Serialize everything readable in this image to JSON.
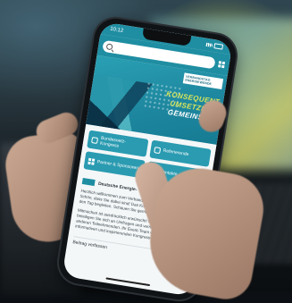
{
  "phone": {
    "time": "10:12",
    "hero": {
      "logo_line1": "VERBANDSTAG",
      "logo_line2": "ENERGIEWENDE",
      "line1": "KONSEQUENT",
      "line2": "UMSETZEN –",
      "line3": "GEMEINSAM."
    },
    "tiles": [
      {
        "label": "Bundesnetz- Kongress"
      },
      {
        "label": "Referierende"
      },
      {
        "label": "Partner & Sponsoren"
      },
      {
        "label": "Kontakte"
      }
    ],
    "org_name": "Deutsche Energie-",
    "paragraph1": "Herzlich willkommen zum Verbandstag Energiewende-Kongress. Schön, dass Sie dabei sind! Das Kongressteam wird Sie durch den Tag begleiten. Schauen Sie gerne wieder rein!",
    "paragraph2": "Mitmachen ist ausdrücklich erwünscht! Nutzen Sie die Bühne, beteiligen Sie sich an Umfragen und vernetzen Sie sich mit anderen Teilnehmenden. Ihr Event-Team wünscht Ihnen einen informativen und inspirierenden Kongress-Tag.",
    "author_link": "Beitrag verfassen"
  },
  "colors": {
    "app_teal": "#1f8ea2",
    "accent_yellow": "#d9e55a"
  },
  "icons": [
    "search-icon",
    "menu-icon",
    "calendar-icon",
    "people-icon",
    "grid-icon",
    "contact-icon"
  ]
}
